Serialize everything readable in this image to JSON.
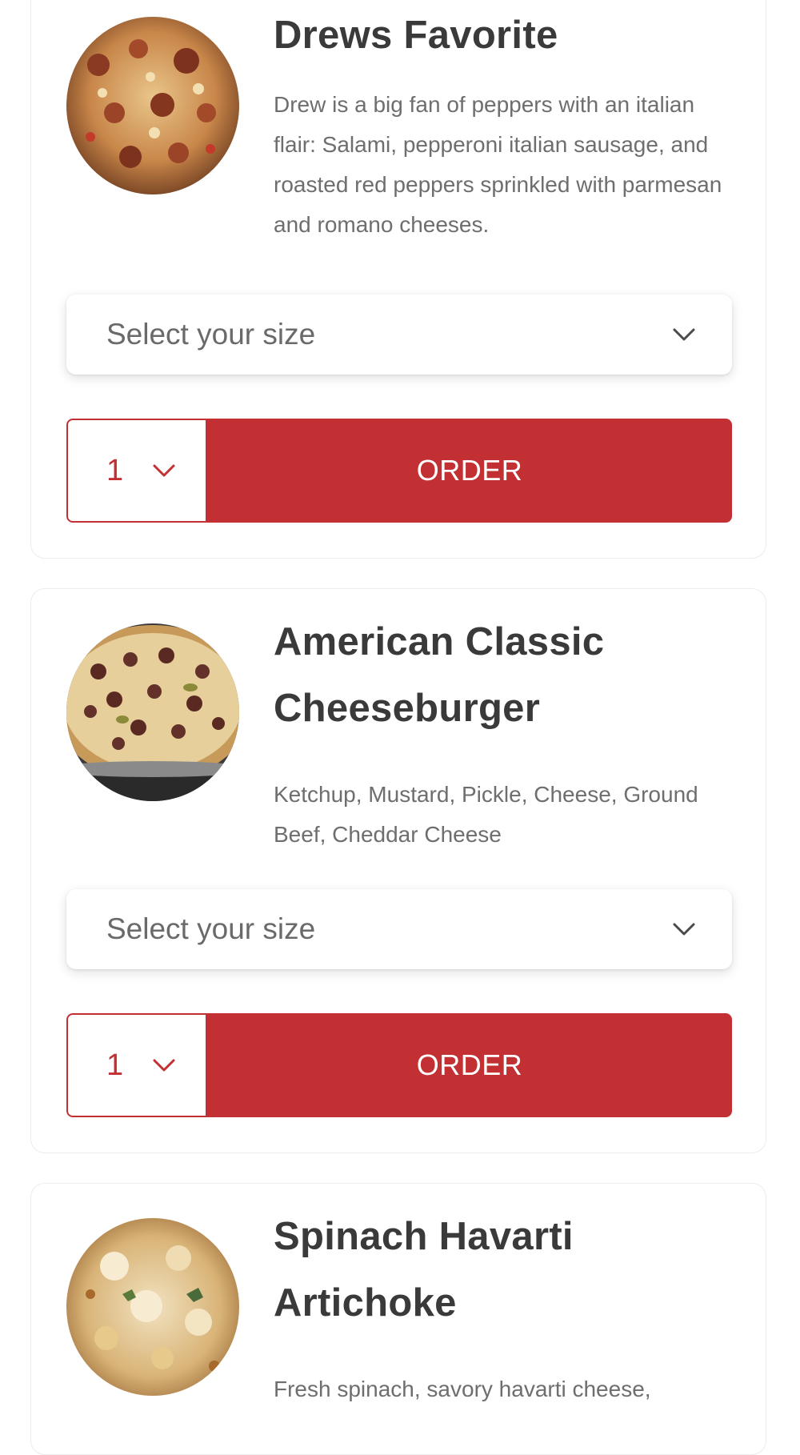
{
  "menu_items": [
    {
      "title": "Drews Favorite",
      "description": "Drew is a big fan of peppers with an italian flair: Salami, pepperoni italian sausage, and roasted red peppers sprinkled with parmesan and romano cheeses.",
      "size_placeholder": "Select your size",
      "quantity": "1",
      "order_label": "ORDER"
    },
    {
      "title": "American Classic Cheeseburger",
      "description": "Ketchup, Mustard, Pickle, Cheese, Ground Beef, Cheddar Cheese",
      "size_placeholder": "Select your size",
      "quantity": "1",
      "order_label": "ORDER"
    },
    {
      "title": "Spinach Havarti Artichoke",
      "description": "Fresh spinach, savory havarti cheese,"
    }
  ],
  "colors": {
    "accent": "#c33033",
    "title_text": "#3a3a3a",
    "body_text": "#6e6e6e",
    "card_border": "#ececec"
  },
  "icons": {
    "dropdown": "chevron-down-icon"
  }
}
